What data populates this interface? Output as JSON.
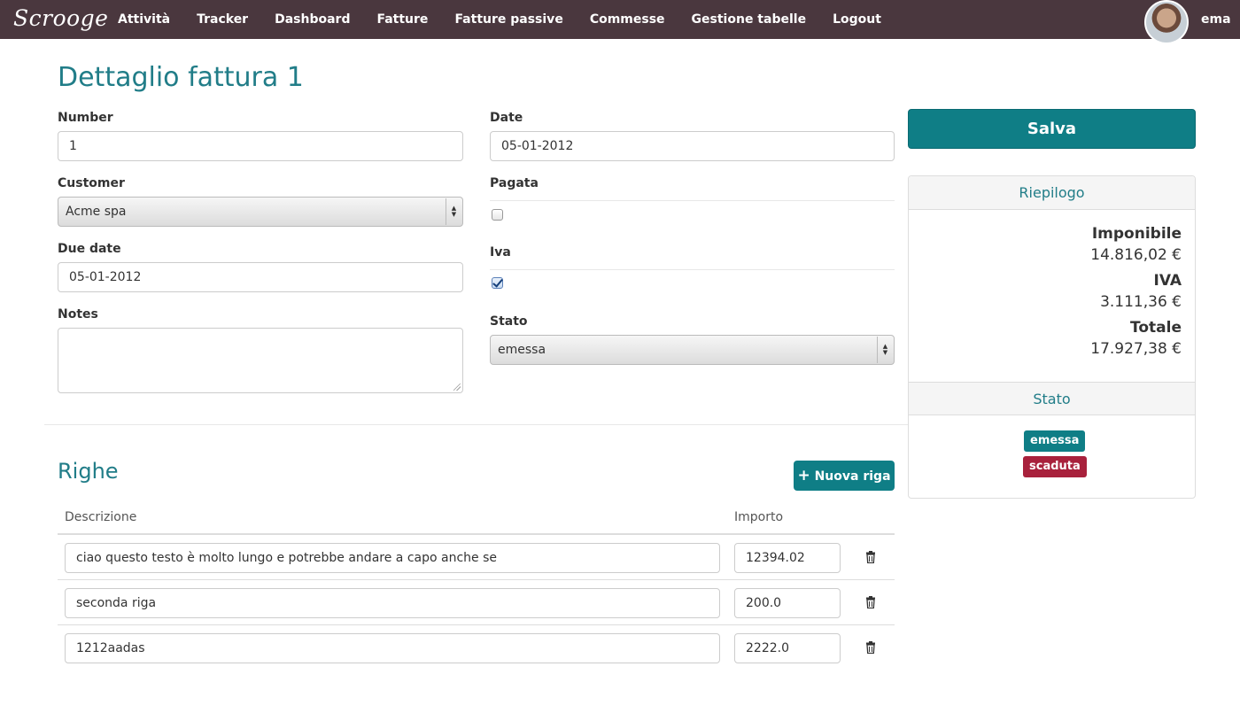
{
  "nav": {
    "brand": "Scrooge",
    "items": [
      {
        "label": "Attività"
      },
      {
        "label": "Tracker"
      },
      {
        "label": "Dashboard"
      },
      {
        "label": "Fatture"
      },
      {
        "label": "Fatture passive"
      },
      {
        "label": "Commesse"
      },
      {
        "label": "Gestione tabelle"
      },
      {
        "label": "Logout"
      }
    ],
    "user": "ema"
  },
  "page": {
    "title": "Dettaglio fattura 1"
  },
  "form": {
    "number_label": "Number",
    "number_value": "1",
    "customer_label": "Customer",
    "customer_value": "Acme spa",
    "due_date_label": "Due date",
    "due_date_value": "05-01-2012",
    "notes_label": "Notes",
    "notes_value": "",
    "date_label": "Date",
    "date_value": "05-01-2012",
    "pagata_label": "Pagata",
    "pagata_checked": false,
    "iva_label": "Iva",
    "iva_checked": true,
    "stato_label": "Stato",
    "stato_value": "emessa"
  },
  "actions": {
    "save_label": "Salva",
    "add_row_label": "Nuova riga"
  },
  "summary": {
    "title": "Riepilogo",
    "imponibile_label": "Imponibile",
    "imponibile_value": "14.816,02 €",
    "iva_label": "IVA",
    "iva_value": "3.111,36 €",
    "totale_label": "Totale",
    "totale_value": "17.927,38 €",
    "stato_title": "Stato",
    "badges": [
      {
        "label": "emessa",
        "color": "#0f7e86"
      },
      {
        "label": "scaduta",
        "color": "#a8213c"
      }
    ]
  },
  "righe": {
    "title": "Righe",
    "col_descrizione": "Descrizione",
    "col_importo": "Importo",
    "rows": [
      {
        "descrizione": "ciao questo testo è molto lungo e potrebbe andare a capo anche se",
        "importo": "12394.02"
      },
      {
        "descrizione": "seconda riga",
        "importo": "200.0"
      },
      {
        "descrizione": "1212aadas",
        "importo": "2222.0"
      }
    ]
  },
  "colors": {
    "navbar": "#4a373e",
    "accent": "#0f7e86",
    "heading": "#217d88",
    "danger": "#a8213c"
  }
}
